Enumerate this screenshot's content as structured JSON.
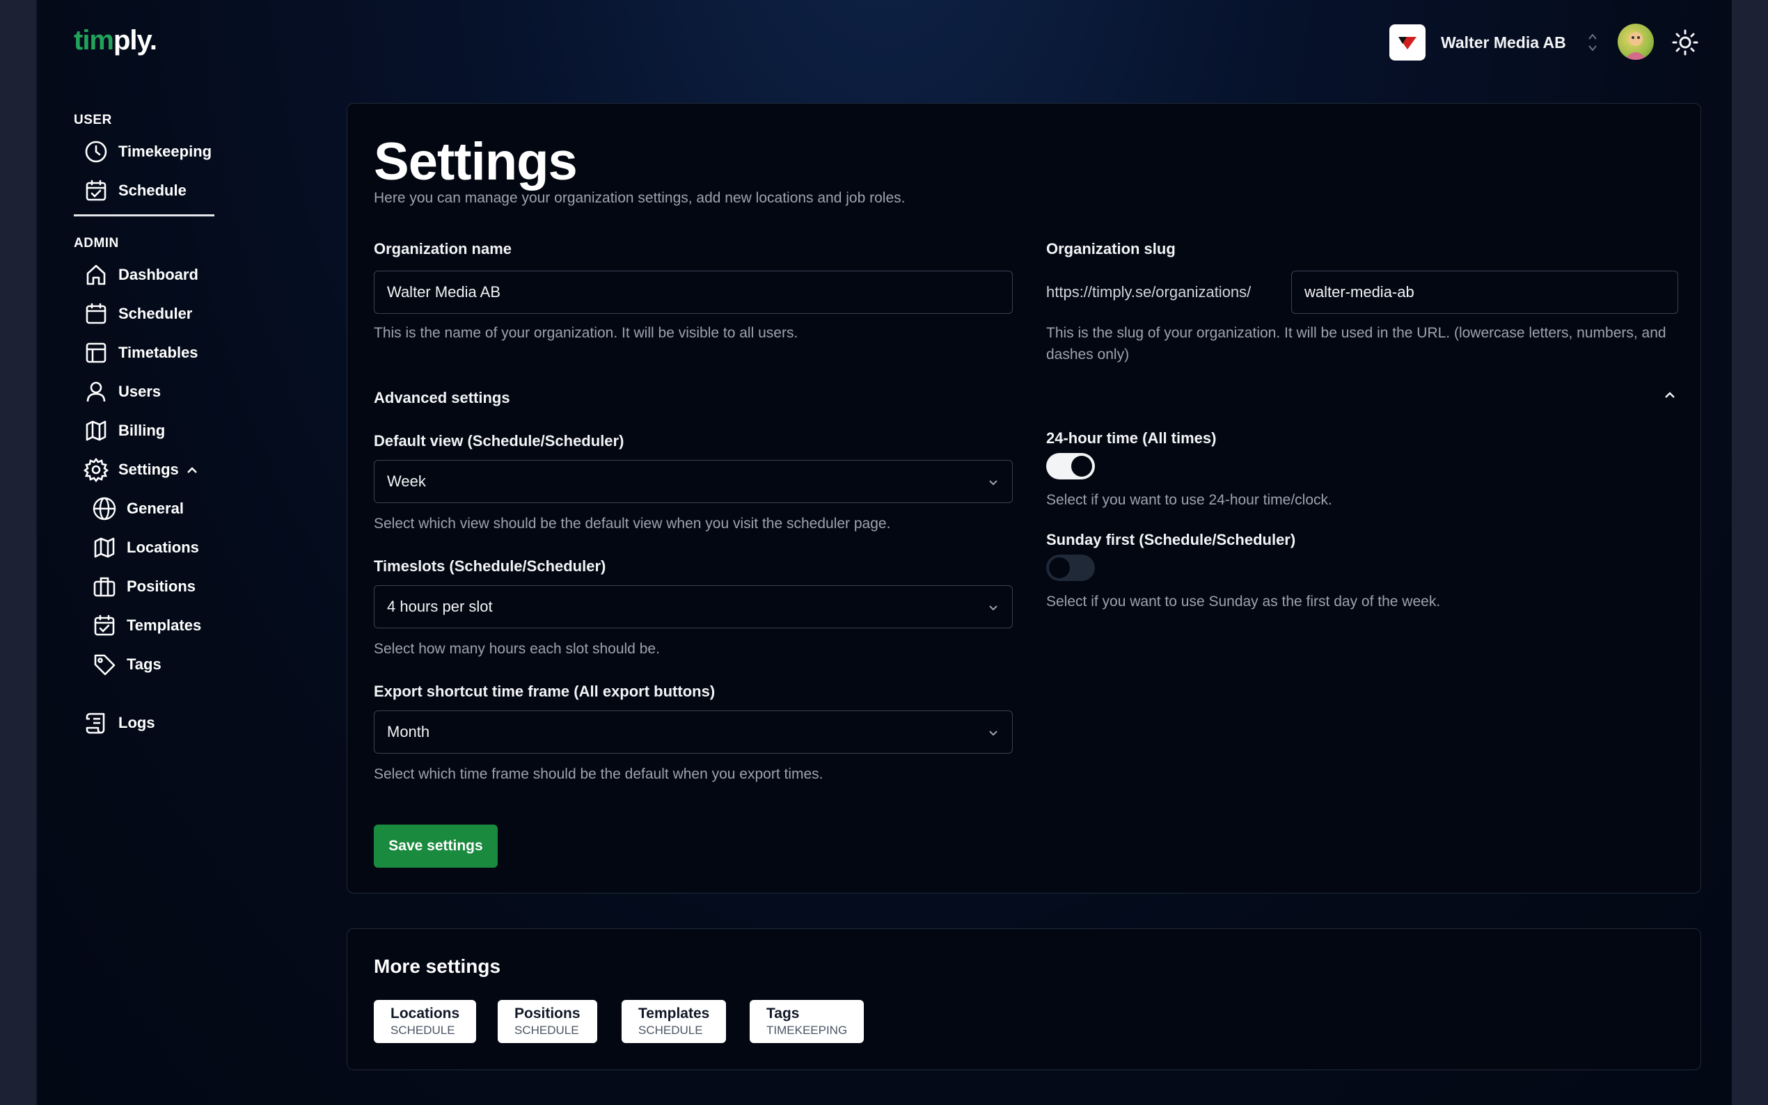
{
  "header": {
    "logo_part1": "tim",
    "logo_part2": "ply.",
    "org_name": "Walter Media AB"
  },
  "sidebar": {
    "user_label": "USER",
    "user_items": [
      {
        "label": "Timekeeping",
        "icon": "clock-icon"
      },
      {
        "label": "Schedule",
        "icon": "calendar-check-icon"
      }
    ],
    "admin_label": "ADMIN",
    "admin_items": [
      {
        "label": "Dashboard",
        "icon": "home-icon"
      },
      {
        "label": "Scheduler",
        "icon": "calendar-icon"
      },
      {
        "label": "Timetables",
        "icon": "table-icon"
      },
      {
        "label": "Users",
        "icon": "user-icon"
      },
      {
        "label": "Billing",
        "icon": "map-icon"
      },
      {
        "label": "Settings",
        "icon": "gear-icon"
      }
    ],
    "settings_sub": [
      {
        "label": "General",
        "icon": "globe-icon"
      },
      {
        "label": "Locations",
        "icon": "map-icon"
      },
      {
        "label": "Positions",
        "icon": "briefcase-icon"
      },
      {
        "label": "Templates",
        "icon": "calendar-check-icon"
      },
      {
        "label": "Tags",
        "icon": "tag-icon"
      }
    ],
    "logs_label": "Logs"
  },
  "settings": {
    "title": "Settings",
    "subtitle": "Here you can manage your organization settings, add new locations and job roles.",
    "org_name_label": "Organization name",
    "org_name_value": "Walter Media AB",
    "org_name_help": "This is the name of your organization. It will be visible to all users.",
    "org_slug_label": "Organization slug",
    "org_slug_prefix": "https://timply.se/organizations/",
    "org_slug_value": "walter-media-ab",
    "org_slug_help": "This is the slug of your organization. It will be used in the URL. (lowercase letters, numbers, and dashes only)",
    "advanced_label": "Advanced settings",
    "default_view_label": "Default view (Schedule/Scheduler)",
    "default_view_value": "Week",
    "default_view_help": "Select which view should be the default view when you visit the scheduler page.",
    "timeslots_label": "Timeslots (Schedule/Scheduler)",
    "timeslots_value": "4 hours per slot",
    "timeslots_help": "Select how many hours each slot should be.",
    "export_label": "Export shortcut time frame (All export buttons)",
    "export_value": "Month",
    "export_help": "Select which time frame should be the default when you export times.",
    "hour24_label": "24-hour time (All times)",
    "hour24_on": true,
    "hour24_help": "Select if you want to use 24-hour time/clock.",
    "sunday_label": "Sunday first (Schedule/Scheduler)",
    "sunday_on": false,
    "sunday_help": "Select if you want to use Sunday as the first day of the week.",
    "save_label": "Save settings"
  },
  "more_settings": {
    "title": "More settings",
    "chips": [
      {
        "title": "Locations",
        "sub": "SCHEDULE"
      },
      {
        "title": "Positions",
        "sub": "SCHEDULE"
      },
      {
        "title": "Templates",
        "sub": "SCHEDULE"
      },
      {
        "title": "Tags",
        "sub": "TIMEKEEPING"
      }
    ]
  }
}
